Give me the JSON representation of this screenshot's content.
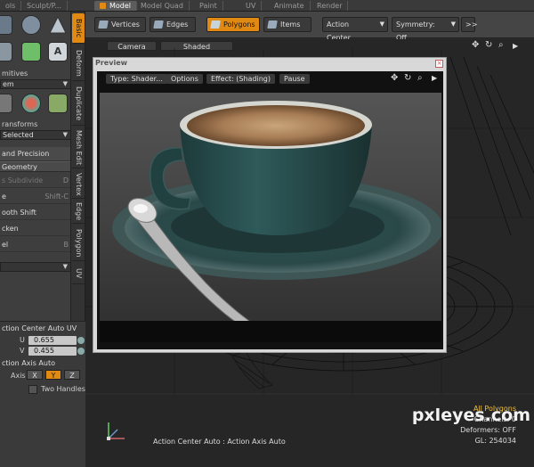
{
  "tabs": [
    {
      "label": "ols",
      "active": false
    },
    {
      "label": "Sculpt/P...",
      "active": false
    },
    {
      "label": "Model",
      "active": true
    },
    {
      "label": "Model Quad",
      "active": false
    },
    {
      "label": "Paint",
      "active": false
    },
    {
      "label": "UV",
      "active": false
    },
    {
      "label": "Animate",
      "active": false
    },
    {
      "label": "Render",
      "active": false
    }
  ],
  "left_panel": {
    "primitives_label": "mitives",
    "item_dropdown": "em",
    "transforms_label": "ransforms",
    "selected_dropdown": "Selected",
    "precision_button": "and Precision",
    "geometry_header": "Geometry",
    "tools": [
      {
        "label": "s Subdivide",
        "key": "D",
        "dim": true
      },
      {
        "label": "e",
        "key": "Shift-C",
        "dim": false
      },
      {
        "label": "ooth Shift",
        "key": "",
        "dim": false
      },
      {
        "label": "cken",
        "key": "",
        "dim": false
      },
      {
        "label": "el",
        "key": "B",
        "dim": false
      }
    ]
  },
  "vertical_tabs": [
    "Basic",
    "Deform",
    "Duplicate",
    "Mesh Edit",
    "Vertex",
    "Edge",
    "Polygon",
    "UV"
  ],
  "uv_panel": {
    "title": "ction Center Auto UV",
    "u_label": "U",
    "u_value": "0.655",
    "v_label": "V",
    "v_value": "0.455",
    "axis_title": "ction Axis Auto",
    "axis_label": "Axis",
    "axis_options": [
      "X",
      "Y",
      "Z"
    ],
    "axis_active": "Y",
    "two_handles": "Two Handles"
  },
  "toolbar": {
    "vertices": "Vertices",
    "edges": "Edges",
    "polygons": "Polygons",
    "items": "Items",
    "action_center": "Action Center",
    "symmetry": "Symmetry: Off",
    "more": ">>"
  },
  "viewport": {
    "camera": "Camera",
    "shaded": "Shaded",
    "nav_icons": [
      "move-icon",
      "rotate-icon",
      "zoom-icon",
      "menu-arrow-icon"
    ],
    "status": {
      "title": "All Polygons",
      "channels": "Channels: 0",
      "deformers": "Deformers: OFF",
      "gl": "GL: 254034"
    },
    "bottom_label": "Action Center Auto : Action Axis Auto"
  },
  "preview": {
    "title": "Preview",
    "buttons": [
      "Type: Shader...",
      "Options",
      "Effect: (Shading)",
      "Pause"
    ]
  },
  "watermark": "pxleyes.com",
  "colors": {
    "accent": "#e08a14",
    "panel": "#3e3e3e",
    "viewport": "#262626"
  }
}
